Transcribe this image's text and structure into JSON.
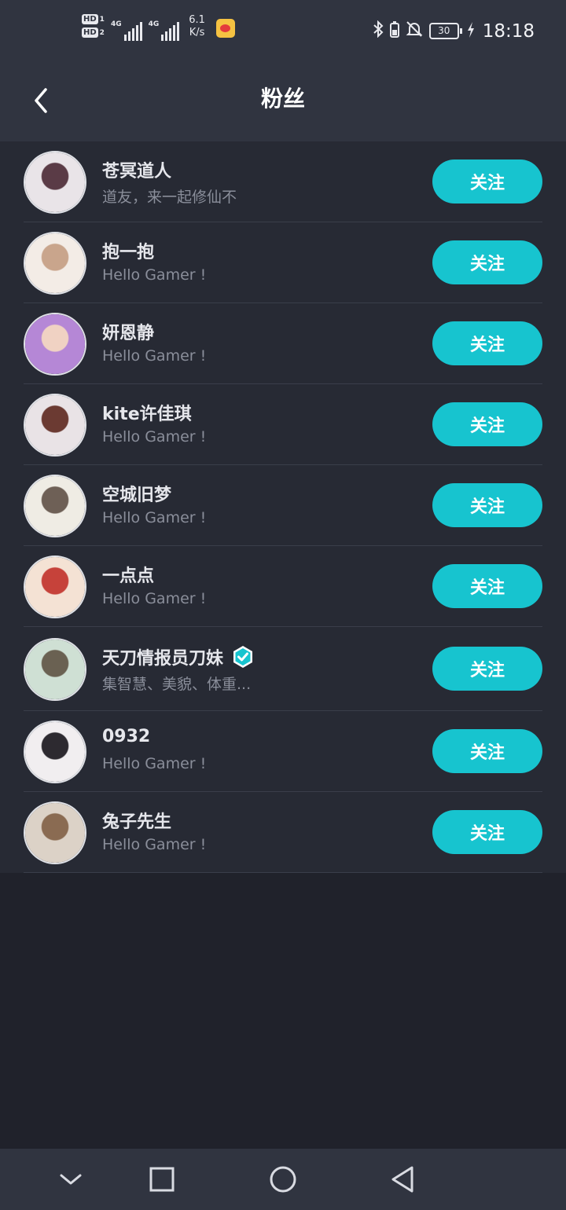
{
  "status_bar": {
    "hd1": "HD",
    "hd1_num": "1",
    "hd2": "HD",
    "hd2_num": "2",
    "signal1_label": "4G",
    "signal2_label": "4G",
    "speed_value": "6.1",
    "speed_unit": "K/s",
    "battery": "30",
    "time": "18:18"
  },
  "header": {
    "title": "粉丝"
  },
  "fans": [
    {
      "name": "苍冥道人",
      "bio": "道友，来一起修仙不",
      "follow_label": "关注",
      "verified": false,
      "avatar_colors": [
        "#e9e4e8",
        "#5a3b46"
      ]
    },
    {
      "name": "抱一抱",
      "bio": "Hello Gamer !",
      "follow_label": "关注",
      "verified": false,
      "avatar_colors": [
        "#f3ece6",
        "#c9a58c"
      ]
    },
    {
      "name": "妍恩静",
      "bio": "Hello Gamer !",
      "follow_label": "关注",
      "verified": false,
      "avatar_colors": [
        "#b587d6",
        "#f0d2c3"
      ]
    },
    {
      "name": "kite许佳琪",
      "bio": "Hello Gamer !",
      "follow_label": "关注",
      "verified": false,
      "avatar_colors": [
        "#e9e3e6",
        "#6b3a32"
      ]
    },
    {
      "name": "空城旧梦",
      "bio": "Hello Gamer !",
      "follow_label": "关注",
      "verified": false,
      "avatar_colors": [
        "#efece4",
        "#6e6056"
      ]
    },
    {
      "name": "一点点",
      "bio": "Hello Gamer !",
      "follow_label": "关注",
      "verified": false,
      "avatar_colors": [
        "#f4e2d4",
        "#c6423a"
      ]
    },
    {
      "name": "天刀情报员刀妹",
      "bio": "集智慧、美貌、体重...",
      "follow_label": "关注",
      "verified": true,
      "avatar_colors": [
        "#cfe0d4",
        "#6a6152"
      ]
    },
    {
      "name": "0932",
      "bio": "Hello Gamer !",
      "follow_label": "关注",
      "verified": false,
      "avatar_colors": [
        "#f1eef0",
        "#2d2a30"
      ]
    },
    {
      "name": "兔子先生",
      "bio": "Hello Gamer !",
      "follow_label": "关注",
      "verified": false,
      "avatar_colors": [
        "#dcd2c7",
        "#8a6b52"
      ]
    }
  ],
  "colors": {
    "accent": "#17c4cf",
    "background": "#20222b",
    "bars": "#303440",
    "list": "#272a34"
  },
  "nav": {
    "icons": [
      "chevron-down-icon",
      "square-icon",
      "circle-home-icon",
      "triangle-back-icon"
    ]
  }
}
